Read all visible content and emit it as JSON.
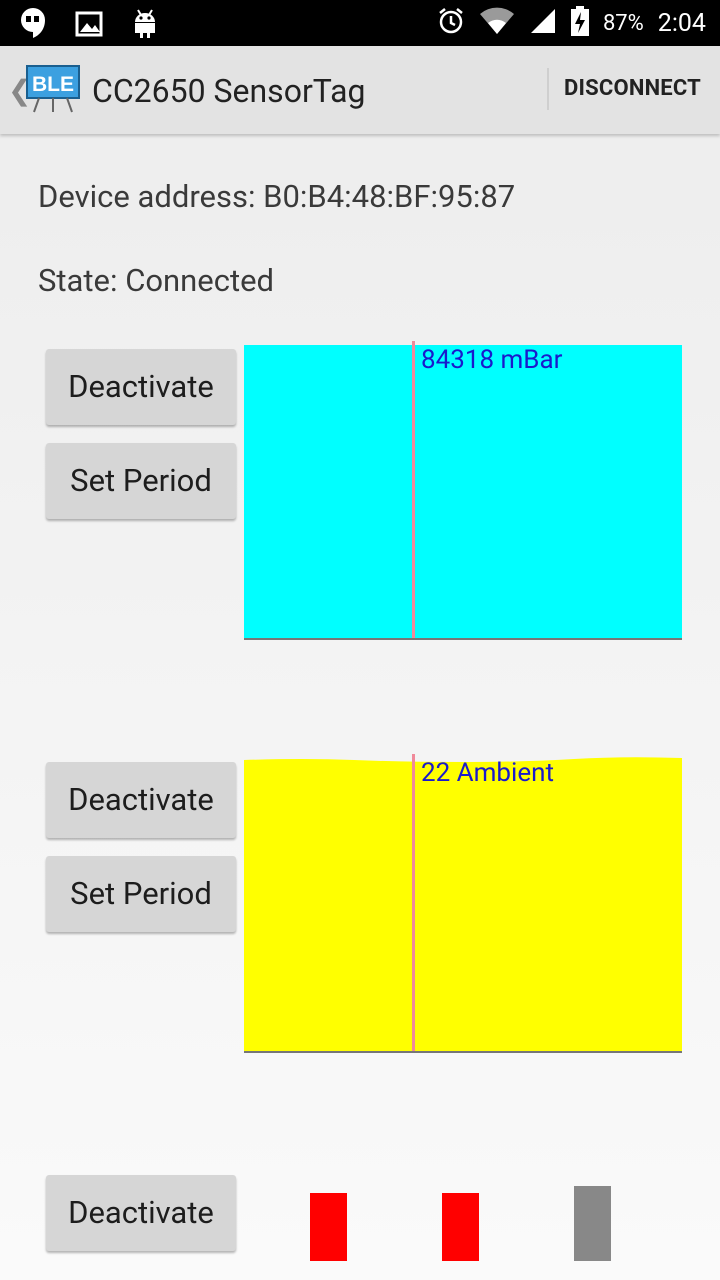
{
  "status_bar": {
    "battery_percent": "87%",
    "time": "2:04",
    "left_icons": [
      "hangouts-icon",
      "image-icon",
      "android-icon"
    ],
    "right_icons": [
      "alarm-icon",
      "wifi-icon",
      "signal-icon",
      "battery-charging-icon"
    ]
  },
  "action_bar": {
    "logo_text": "BLE",
    "title": "CC2650 SensorTag",
    "disconnect_label": "DISCONNECT"
  },
  "device": {
    "address_label": "Device address: B0:B4:48:BF:95:87",
    "state_label": "State: Connected"
  },
  "sensors": [
    {
      "deactivate_label": "Deactivate",
      "set_period_label": "Set Period",
      "graph_label": "84318 mBar",
      "graph_color": "#00ffff"
    },
    {
      "deactivate_label": "Deactivate",
      "set_period_label": "Set Period",
      "graph_label": "22 Ambient",
      "graph_color": "#ffff00"
    },
    {
      "deactivate_label": "Deactivate",
      "indicator_colors": [
        "#ff0000",
        "#ff0000",
        "#888888"
      ]
    }
  ],
  "colors": {
    "accent_text": "#1a1acc",
    "cursor_line": "#f08a9a"
  }
}
